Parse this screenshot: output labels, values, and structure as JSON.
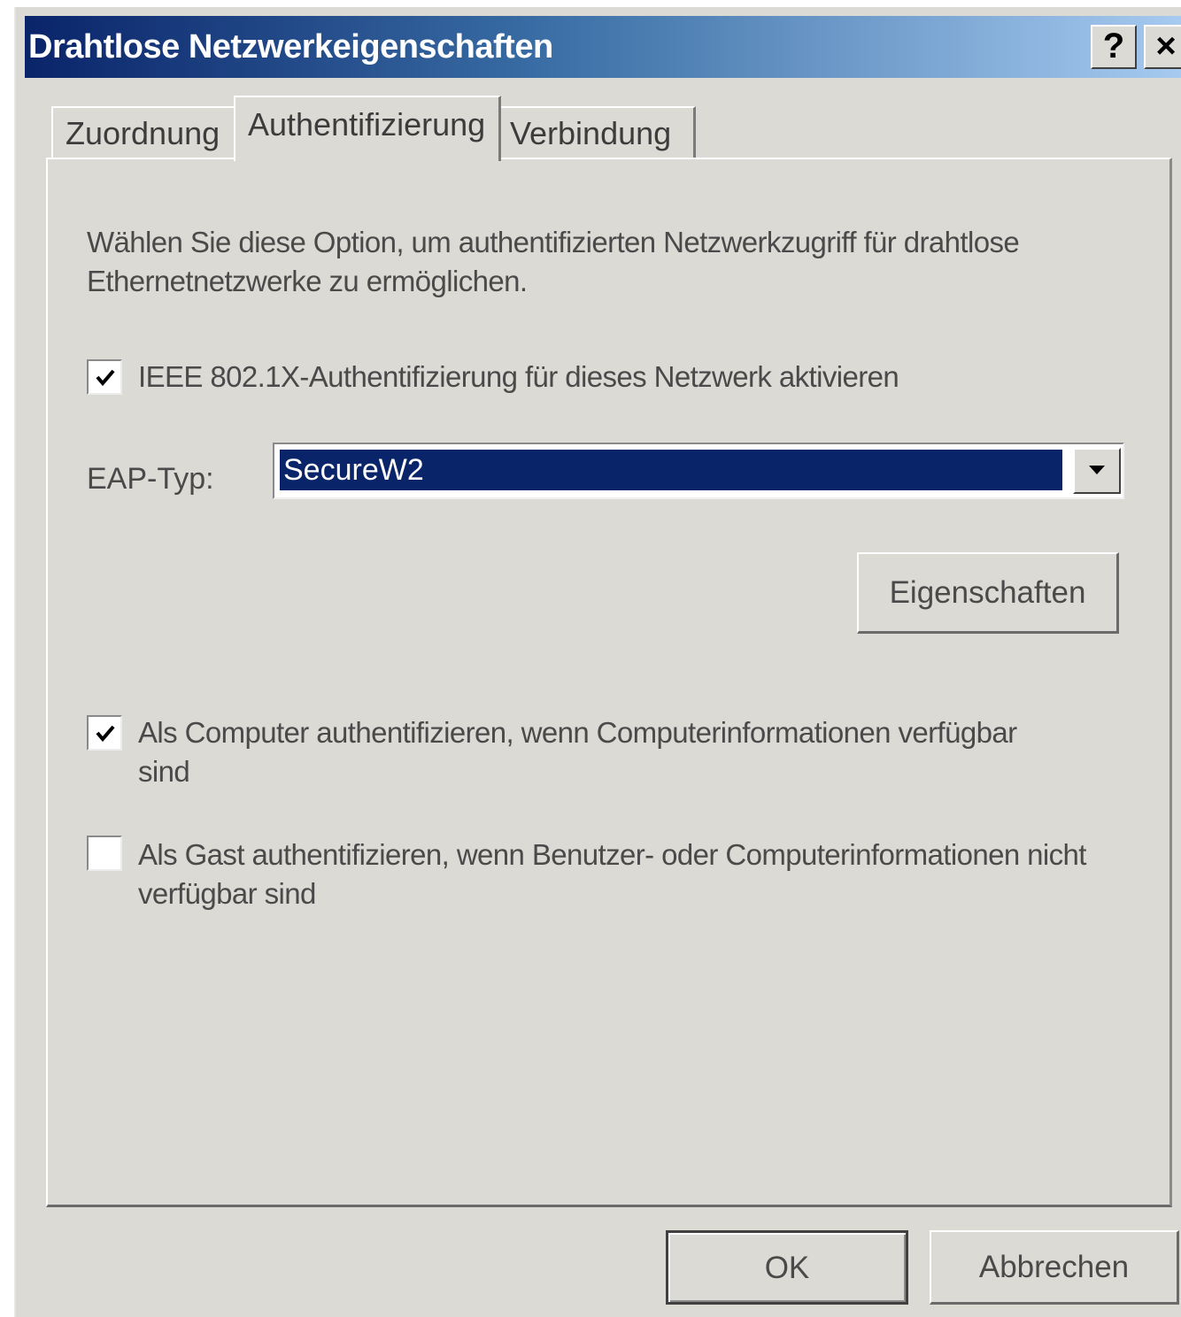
{
  "window": {
    "title": "Drahtlose Netzwerkeigenschaften",
    "help_label": "?",
    "close_label": "×"
  },
  "tabs": [
    {
      "label": "Zuordnung",
      "active": false
    },
    {
      "label": "Authentifizierung",
      "active": true
    },
    {
      "label": "Verbindung",
      "active": false
    }
  ],
  "auth": {
    "description": "Wählen Sie diese Option, um authentifizierten Netzwerkzugriff für drahtlose Ethernetnetzwerke zu ermöglichen.",
    "ieee_checkbox": {
      "label": "IEEE 802.1X-Authentifizierung für dieses Netzwerk aktivieren",
      "checked": true
    },
    "eap_label": "EAP-Typ:",
    "eap_value": "SecureW2",
    "properties_button": "Eigenschaften",
    "computer_checkbox": {
      "label": "Als Computer authentifizieren, wenn Computerinformationen verfügbar sind",
      "checked": true
    },
    "guest_checkbox": {
      "label": "Als Gast authentifizieren, wenn Benutzer- oder Computerinformationen nicht verfügbar sind",
      "checked": false
    }
  },
  "footer": {
    "ok_label": "OK",
    "cancel_label": "Abbrechen"
  },
  "colors": {
    "titlebar_start": "#0a246a",
    "titlebar_end": "#a6caf0",
    "selection": "#0a246a",
    "dialog_bg": "#dcdad5"
  }
}
